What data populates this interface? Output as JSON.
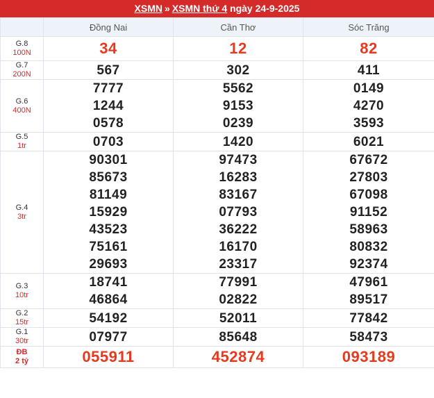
{
  "header": {
    "link1": "XSMN",
    "sep": "»",
    "link2": "XSMN thứ 4",
    "text": "ngày 24-9-2025"
  },
  "provinces": [
    "Đồng Nai",
    "Cần Thơ",
    "Sóc Trăng"
  ],
  "rows": [
    {
      "name": "G.8",
      "amount": "100N",
      "style": "big",
      "cols": [
        [
          "34"
        ],
        [
          "12"
        ],
        [
          "82"
        ]
      ]
    },
    {
      "name": "G.7",
      "amount": "200N",
      "style": "",
      "cols": [
        [
          "567"
        ],
        [
          "302"
        ],
        [
          "411"
        ]
      ]
    },
    {
      "name": "G.6",
      "amount": "400N",
      "style": "",
      "cols": [
        [
          "7777",
          "1244",
          "0578"
        ],
        [
          "5562",
          "9153",
          "0239"
        ],
        [
          "0149",
          "4270",
          "3593"
        ]
      ]
    },
    {
      "name": "G.5",
      "amount": "1tr",
      "style": "",
      "cols": [
        [
          "0703"
        ],
        [
          "1420"
        ],
        [
          "6021"
        ]
      ]
    },
    {
      "name": "G.4",
      "amount": "3tr",
      "style": "",
      "cols": [
        [
          "90301",
          "85673",
          "81149",
          "15929",
          "43523",
          "75161",
          "29693"
        ],
        [
          "97473",
          "16283",
          "83167",
          "07793",
          "36222",
          "16170",
          "23317"
        ],
        [
          "67672",
          "27803",
          "67098",
          "91152",
          "58963",
          "80832",
          "92374"
        ]
      ]
    },
    {
      "name": "G.3",
      "amount": "10tr",
      "style": "",
      "cols": [
        [
          "18741",
          "46864"
        ],
        [
          "77991",
          "02822"
        ],
        [
          "47961",
          "89517"
        ]
      ]
    },
    {
      "name": "G.2",
      "amount": "15tr",
      "style": "",
      "cols": [
        [
          "54192"
        ],
        [
          "52011"
        ],
        [
          "77842"
        ]
      ]
    },
    {
      "name": "G.1",
      "amount": "30tr",
      "style": "",
      "cols": [
        [
          "07977"
        ],
        [
          "85648"
        ],
        [
          "58473"
        ]
      ]
    },
    {
      "name": "ĐB",
      "amount": "2 tỷ",
      "style": "db",
      "cols": [
        [
          "055911"
        ],
        [
          "452874"
        ],
        [
          "093189"
        ]
      ]
    }
  ]
}
